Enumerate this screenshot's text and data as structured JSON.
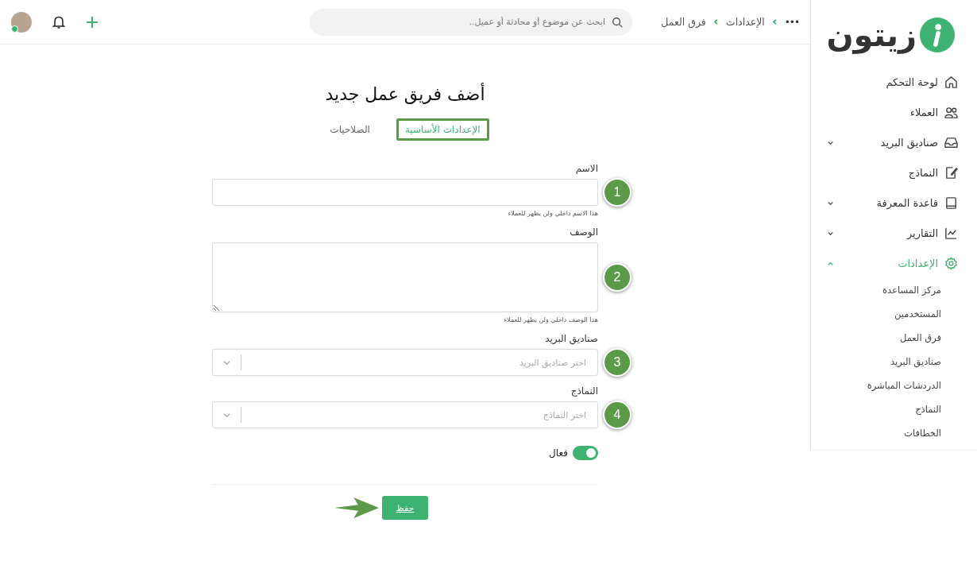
{
  "logo": {
    "text": "زيتون"
  },
  "sidebar": {
    "items": [
      {
        "label": "لوحة التحكم",
        "selected": false
      },
      {
        "label": "العملاء",
        "selected": false
      },
      {
        "label": "صناديق البريد",
        "selected": false,
        "expanded": false
      },
      {
        "label": "النماذج",
        "selected": false
      },
      {
        "label": "قاعدة المعرفة",
        "selected": false,
        "expanded": false
      },
      {
        "label": "التقارير",
        "selected": false,
        "expanded": false
      },
      {
        "label": "الإعدادات",
        "selected": true,
        "expanded": true,
        "children": [
          {
            "label": "مركز المساعدة"
          },
          {
            "label": "المستخدمين"
          },
          {
            "label": "فرق العمل"
          },
          {
            "label": "صناديق البريد"
          },
          {
            "label": "الدردشات المباشرة"
          },
          {
            "label": "النماذج"
          },
          {
            "label": "الخطافات"
          }
        ]
      }
    ]
  },
  "topbar": {
    "more": "•••",
    "breadcrumb": [
      "الإعدادات",
      "فرق العمل"
    ],
    "search": {
      "placeholder": "ابحث عن موضوع أو محادثة أو عميل.."
    }
  },
  "form": {
    "title": "أضف فريق عمل جديد",
    "tabs": [
      {
        "label": "الإعدادات الأساسية",
        "selected": true
      },
      {
        "label": "الصلاحيات",
        "selected": false
      }
    ],
    "fields": [
      {
        "kind": "input",
        "label": "الاسم",
        "hint": "هذا الاسم داخلي ولن يظهر للعملاء",
        "step": "1"
      },
      {
        "kind": "textarea",
        "label": "الوصف",
        "hint": "هذا الوصف داخلي ولن يظهر للعملاء",
        "step": "2"
      },
      {
        "kind": "select",
        "label": "صناديق البريد",
        "placeholder": "اختر صناديق البريد",
        "step": "3"
      },
      {
        "kind": "select",
        "label": "النماذج",
        "placeholder": "اختر النماذج",
        "step": "4"
      }
    ],
    "toggle": {
      "label": "فعال",
      "on": true
    },
    "save_button": "حفظ"
  }
}
